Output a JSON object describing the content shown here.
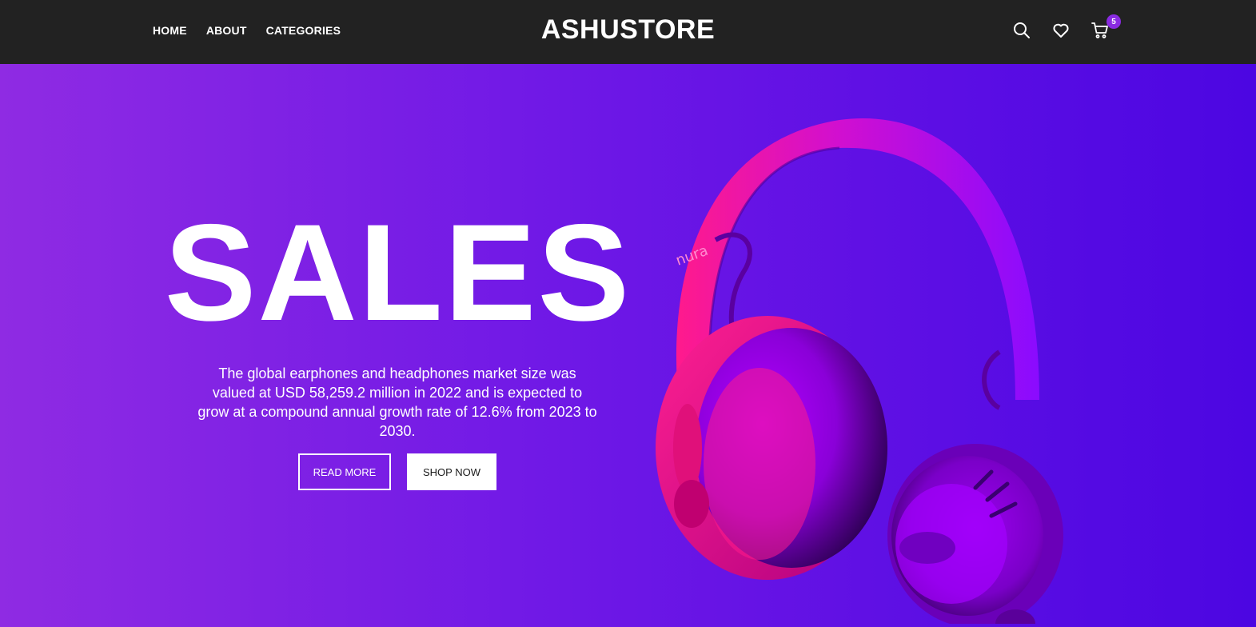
{
  "header": {
    "nav": [
      "HOME",
      "ABOUT",
      "CATEGORIES"
    ],
    "logo": "ASHUSTORE",
    "icons": [
      "search-icon",
      "heart-icon",
      "cart-icon"
    ],
    "cart_count": "5"
  },
  "hero": {
    "title": "SALES",
    "description": "The global earphones and headphones market size was valued at USD 58,259.2 million in 2022 and is expected to grow at a compound annual growth rate of 12.6% from 2023 to 2030.",
    "read_more": "READ MORE",
    "shop_now": "SHOP NOW",
    "product_brand": "nura"
  },
  "colors": {
    "nav_bg": "#222222",
    "hero_gradient_start": "#8f2be3",
    "hero_gradient_end": "#4c06e2",
    "badge": "#8a2be2",
    "headphone_pink": "#ff1a8c",
    "headphone_purple": "#8a0bff"
  }
}
